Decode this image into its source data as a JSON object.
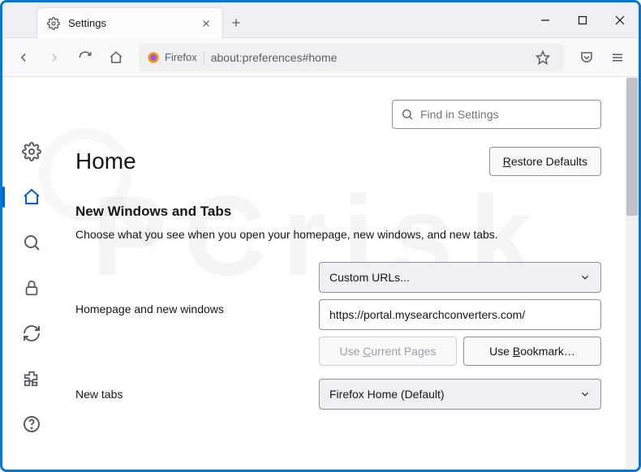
{
  "tab": {
    "title": "Settings"
  },
  "urlbar": {
    "identity": "Firefox",
    "url": "about:preferences#home"
  },
  "search": {
    "placeholder": "Find in Settings"
  },
  "page": {
    "heading": "Home",
    "restore_label": "Restore Defaults"
  },
  "section": {
    "title": "New Windows and Tabs",
    "desc": "Choose what you see when you open your homepage, new windows, and new tabs."
  },
  "homepage": {
    "label": "Homepage and new windows",
    "select": "Custom URLs...",
    "url_value": "https://portal.mysearchconverters.com/",
    "use_current": "Use Current Pages",
    "use_bookmark": "Use Bookmark…"
  },
  "newtabs": {
    "label": "New tabs",
    "select": "Firefox Home (Default)"
  }
}
